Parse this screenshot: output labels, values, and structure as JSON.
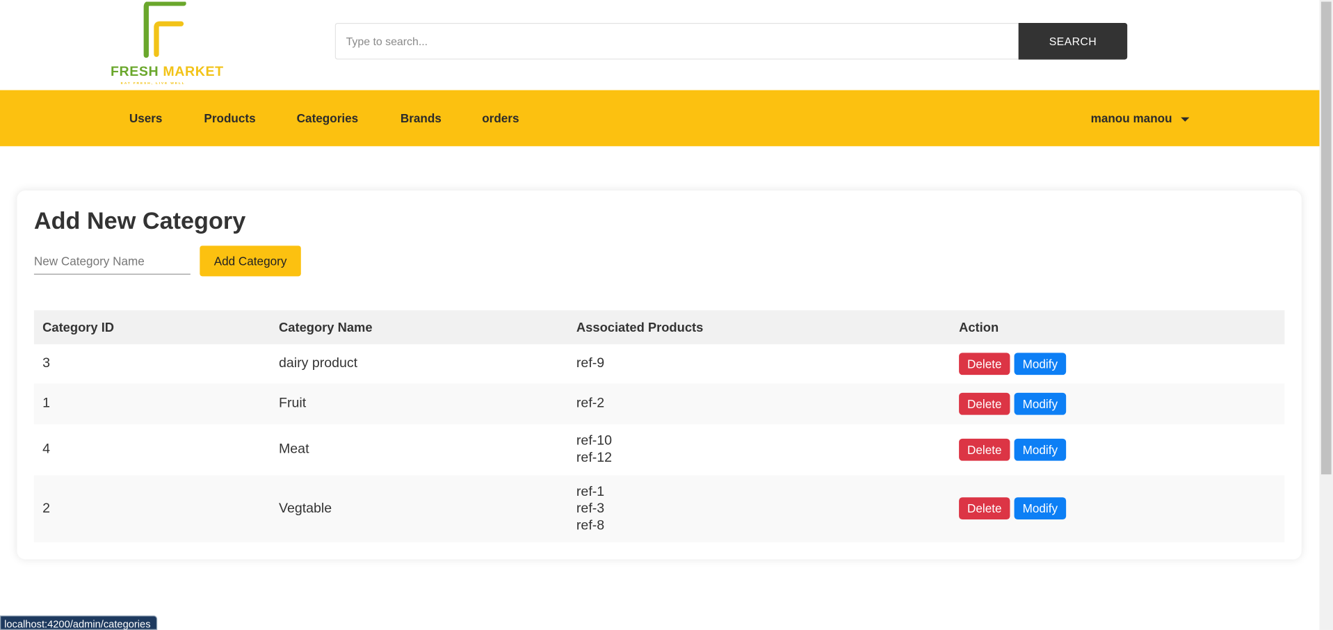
{
  "brand": {
    "name_part1": "FRESH",
    "name_part2": "MARKET",
    "tagline": "EAT FRESH, LIVE WELL",
    "colors": {
      "green": "#6aa72c",
      "yellow": "#f2c318"
    }
  },
  "search": {
    "placeholder": "Type to search...",
    "value": "",
    "button_label": "SEARCH"
  },
  "nav": {
    "items": [
      {
        "label": "Users"
      },
      {
        "label": "Products"
      },
      {
        "label": "Categories"
      },
      {
        "label": "Brands"
      },
      {
        "label": "orders"
      }
    ],
    "user_label": "manou manou",
    "user_icon": "caret-down-icon",
    "accent_color": "#fcc110"
  },
  "main": {
    "title": "Add New Category",
    "input_placeholder": "New Category Name",
    "input_value": "",
    "add_button_label": "Add Category"
  },
  "table": {
    "headers": [
      "Category ID",
      "Category Name",
      "Associated Products",
      "Action"
    ],
    "delete_label": "Delete",
    "modify_label": "Modify",
    "rows": [
      {
        "id": "3",
        "name": "dairy product",
        "products": [
          "ref-9"
        ]
      },
      {
        "id": "1",
        "name": "Fruit",
        "products": [
          "ref-2"
        ]
      },
      {
        "id": "4",
        "name": "Meat",
        "products": [
          "ref-10",
          "ref-12"
        ]
      },
      {
        "id": "2",
        "name": "Vegtable",
        "products": [
          "ref-1",
          "ref-3",
          "ref-8"
        ]
      }
    ],
    "colors": {
      "delete": "#dc3545",
      "modify": "#0d7ff5"
    }
  },
  "status": {
    "url": "localhost:4200/admin/categories"
  }
}
